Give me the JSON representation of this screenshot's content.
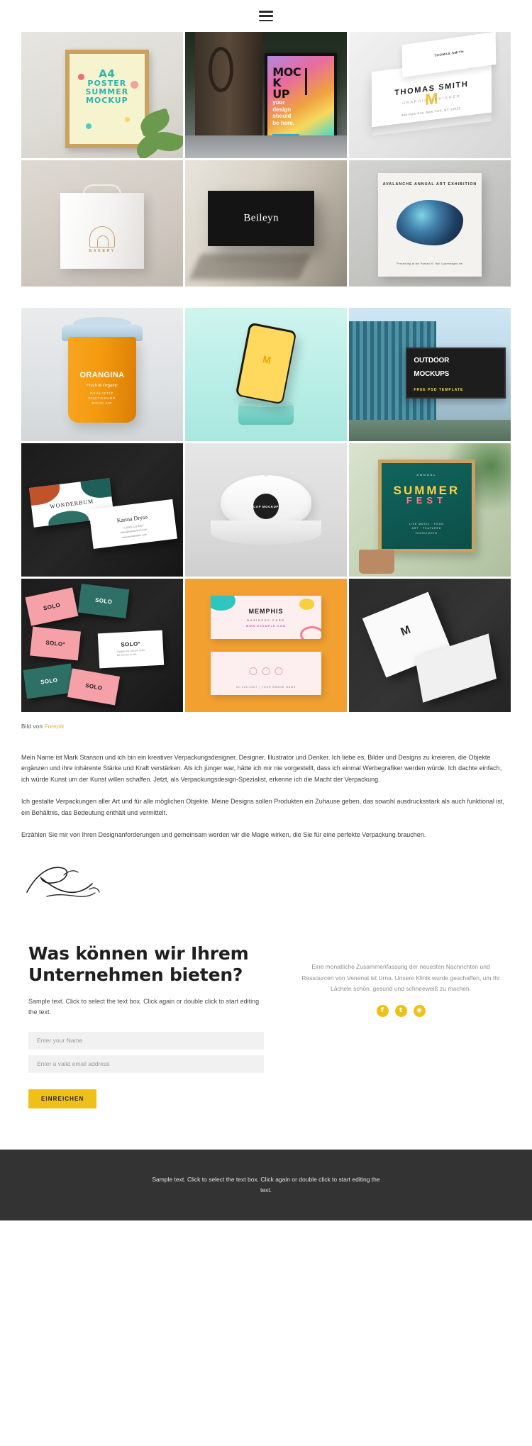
{
  "header": {
    "menu_icon": "hamburger-menu-icon"
  },
  "gallery": {
    "block1": [
      {
        "name": "a4-poster-summer-mockup",
        "title": "A4",
        "line2": "POSTER",
        "line3": "SUMMER",
        "line4": "MOCKUP"
      },
      {
        "name": "billboard-mockup",
        "title_a": "MOC",
        "title_b": "K",
        "title_c": "UP",
        "sub": "your\ndesign\nshould\nbe here."
      },
      {
        "name": "business-card-stack-mockup",
        "top_label": "THOMAS SMITH",
        "name_text": "THOMAS SMITH",
        "monogram": "M",
        "role": "GRAPHIC DESIGNER",
        "address": "485 Park Ave, New York, NY 10022,"
      }
    ],
    "block1_row2": [
      {
        "name": "paper-bag-mockup",
        "logo_word": "BAKERY"
      },
      {
        "name": "black-box-mockup",
        "brand": "Beileyn"
      },
      {
        "name": "art-exhibition-poster-mockup",
        "title": "AVALANCHE ANNUAL ART EXHIBITION",
        "caption": "Presenting at the Parkan N° Hall Copenhagen.net"
      }
    ],
    "block2_row1": [
      {
        "name": "coffee-cup-mockup",
        "brand": "ORANGINA",
        "script": "Fresh & Organic",
        "small": "REALISTIC\nPHOTOSHOP\nMOCK-UP"
      },
      {
        "name": "phone-mockup",
        "screen_letter": "M"
      },
      {
        "name": "outdoor-billboard-mockup",
        "t1": "OUTDOOR",
        "t2": "MOCKUPS",
        "t3": "FREE PSD TEMPLATE"
      }
    ],
    "block2_row2": [
      {
        "name": "wonderbum-business-cards",
        "brand": "WONDERBUM",
        "person": "Karina Dryso",
        "lines": "+1 (555) 123-4567\nhello@wonderbum.com\nwww.wonderbum.com"
      },
      {
        "name": "cap-mockup",
        "badge": "CAP MOCKUP"
      },
      {
        "name": "summer-poster-mockup",
        "kicker": "ANNUAL",
        "big": "SUMMER",
        "accent": "FEST",
        "sub": "LIVE MUSIC · FOOD\nART · FEATURED\nHIGHLIGHTS"
      }
    ],
    "block2_row3": [
      {
        "name": "solo-brand-cards",
        "label": "SOLO",
        "label_alt": "SOLO°",
        "white_sub": "Sample text. Click to select\nthe text box to edit."
      },
      {
        "name": "memphis-business-card",
        "title": "MEMPHIS",
        "sub": "BUSINESS CARD",
        "url": "WWW.EXAMPLE.COM",
        "foot": "00-123-4567  |  YOUR BRAND NAME"
      },
      {
        "name": "postcard-mockup",
        "monogram": "M"
      }
    ]
  },
  "credit": {
    "prefix": "Bild von",
    "link": "Freepik"
  },
  "copy": {
    "paragraphs": [
      "Mein Name ist Mark Stanson und ich bin ein kreativer Verpackungsdesigner, Designer, Illustrator und Denker. Ich liebe es, Bilder und Designs zu kreieren, die Objekte ergänzen und ihre inhärente Stärke und Kraft verstärken. Als ich jünger war, hätte ich mir nie vorgestellt, dass ich einmal Werbegrafiker werden würde. Ich dachte einfach, ich würde Kunst um der Kunst willen schaffen. Jetzt, als Verpackungsdesign-Spezialist, erkenne ich die Macht der Verpackung.",
      "Ich gestalte Verpackungen aller Art und für alle möglichen Objekte. Meine Designs sollen Produkten ein Zuhause geben, das sowohl ausdrucksstark als auch funktional ist, ein Behältnis, das Bedeutung enthält und vermittelt.",
      "Erzählen Sie mir von Ihren Designanforderungen und gemeinsam werden wir die Magie wirken, die Sie für eine perfekte Verpackung brauchen."
    ]
  },
  "cta": {
    "heading": "Was können wir Ihrem Unternehmen bieten?",
    "lead": "Sample text. Click to select the text box. Click again or double click to start editing the text.",
    "name_placeholder": "Enter your Name",
    "email_placeholder": "Enter a valid email address",
    "submit_label": "EINREICHEN",
    "right_text": "Eine monatliche Zusammenfassung der neuesten Nachrichten und Ressourcen von Venenat ist Urna. Unsere Klinik wurde geschaffen, um Ihr Lächeln schön, gesund und schneeweiß zu machen.",
    "socials": [
      {
        "name": "facebook-icon",
        "glyph": "f"
      },
      {
        "name": "twitter-icon",
        "glyph": "t"
      },
      {
        "name": "instagram-icon",
        "glyph": "◉"
      }
    ],
    "accent_color": "#efc01a"
  },
  "footer": {
    "text": "Sample text. Click to select the text box. Click again or double click to start editing the text."
  }
}
